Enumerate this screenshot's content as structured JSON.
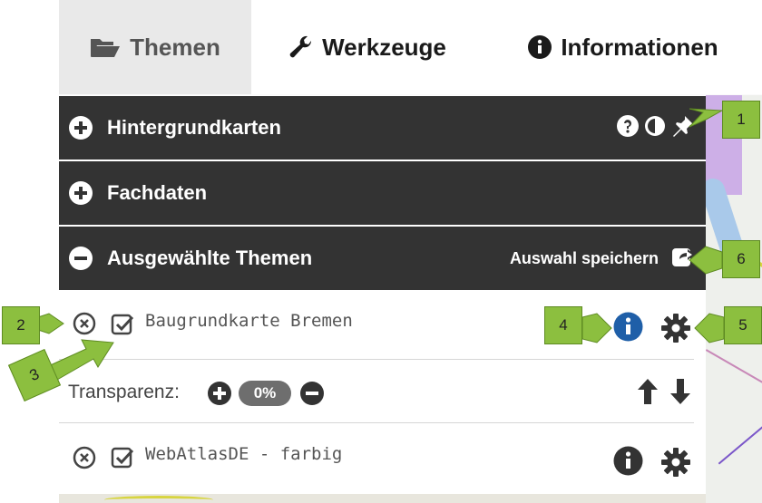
{
  "tabs": [
    {
      "label": "Themen",
      "icon": "folder-open-icon",
      "active": true
    },
    {
      "label": "Werkzeuge",
      "icon": "wrench-icon",
      "active": false
    },
    {
      "label": "Informationen",
      "icon": "info-circle-icon",
      "active": false
    }
  ],
  "sections": {
    "background_maps": {
      "label": "Hintergrundkarten",
      "icon": "plus-circle-icon"
    },
    "technical_data": {
      "label": "Fachdaten",
      "icon": "plus-circle-icon"
    },
    "selected_themes": {
      "label": "Ausgewählte Themen",
      "icon": "minus-circle-icon",
      "save_label": "Auswahl speichern"
    }
  },
  "layers": [
    {
      "name": "Baugrundkarte Bremen",
      "info_color": "#1f5fa8"
    },
    {
      "name": "WebAtlasDE - farbig",
      "info_color": "#333333"
    }
  ],
  "transparency": {
    "label": "Transparenz:",
    "value": "0%"
  },
  "callouts": [
    "1",
    "2",
    "3",
    "4",
    "5",
    "6"
  ],
  "colors": {
    "dark_bar": "#333333",
    "callout_green": "#8cbf3f",
    "info_blue": "#1f5fa8"
  }
}
